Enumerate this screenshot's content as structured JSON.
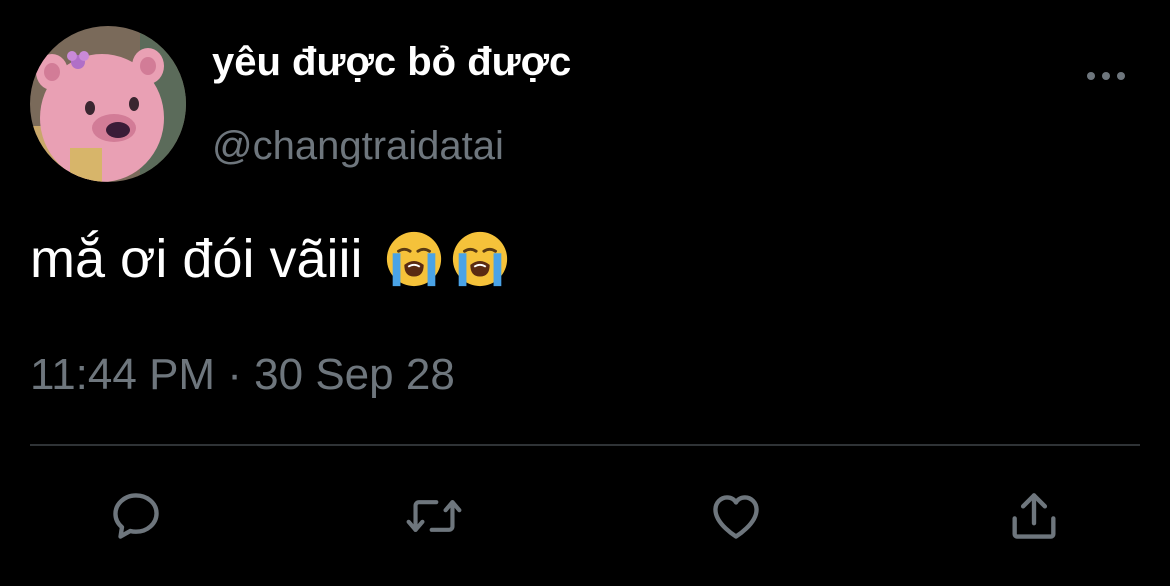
{
  "tweet": {
    "display_name": "yêu được bỏ được",
    "handle": "@changtraidatai",
    "text": "mắ ơi đói vãiii",
    "emojis": [
      "loudly-crying-face-emoji",
      "loudly-crying-face-emoji"
    ],
    "timestamp": "11:44 PM · 30 Sep 28"
  },
  "actions": {
    "reply_icon": "reply-icon",
    "retweet_icon": "retweet-icon",
    "like_icon": "heart-icon",
    "share_icon": "share-icon",
    "more_icon": "more-icon"
  },
  "colors": {
    "background": "#000000",
    "primary_text": "#ffffff",
    "secondary_text": "#6e767d",
    "divider": "#2f3336",
    "avatar_pink": "#e9a0b4"
  }
}
